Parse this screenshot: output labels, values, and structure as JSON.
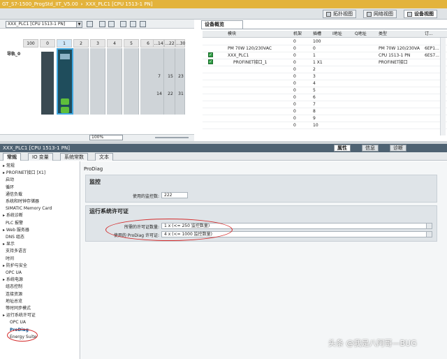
{
  "titlebar": {
    "project": "GT_S7-1500_ProgStd_IIT_V5.00",
    "sep": "›",
    "device": "XXX_PLC1 [CPU 1513-1 PN]"
  },
  "viewtabs": {
    "topology": "拓扑视图",
    "network": "网络视图",
    "device": "设备视图"
  },
  "devview": {
    "device_select": "XXX_PLC1 [CPU 1513-1 PN]",
    "slots": [
      "100",
      "0",
      "1",
      "2",
      "3",
      "4",
      "5",
      "6",
      "...14",
      "...22",
      "...30"
    ],
    "rail_label": "导轨_0",
    "io_numbers": [
      "7",
      "15",
      "23",
      "14",
      "22",
      "31"
    ],
    "zoom": "100%"
  },
  "overview": {
    "tab": "设备概览",
    "headers": [
      "模块",
      "机架",
      "插槽",
      "I地址",
      "Q地址",
      "类型",
      "订..."
    ],
    "rows": [
      {
        "module": "",
        "rack": "0",
        "slot": "100",
        "type": "",
        "order": "",
        "checked": false
      },
      {
        "module": "PM 70W 120/230VAC",
        "rack": "0",
        "slot": "0",
        "type": "PM 70W 120/230VA",
        "order": "6EP1...",
        "checked": false
      },
      {
        "module": "XXX_PLC1",
        "rack": "0",
        "slot": "1",
        "type": "CPU 1513-1 PN",
        "order": "6ES7...",
        "checked": true
      },
      {
        "module": "PROFINET接口_1",
        "rack": "0",
        "slot": "1 X1",
        "type": "PROFINET接口",
        "order": "",
        "checked": true
      },
      {
        "module": "",
        "rack": "0",
        "slot": "2",
        "type": "",
        "order": "",
        "checked": false
      },
      {
        "module": "",
        "rack": "0",
        "slot": "3",
        "type": "",
        "order": "",
        "checked": false
      },
      {
        "module": "",
        "rack": "0",
        "slot": "4",
        "type": "",
        "order": "",
        "checked": false
      },
      {
        "module": "",
        "rack": "0",
        "slot": "5",
        "type": "",
        "order": "",
        "checked": false
      },
      {
        "module": "",
        "rack": "0",
        "slot": "6",
        "type": "",
        "order": "",
        "checked": false
      },
      {
        "module": "",
        "rack": "0",
        "slot": "7",
        "type": "",
        "order": "",
        "checked": false
      },
      {
        "module": "",
        "rack": "0",
        "slot": "8",
        "type": "",
        "order": "",
        "checked": false
      },
      {
        "module": "",
        "rack": "0",
        "slot": "9",
        "type": "",
        "order": "",
        "checked": false
      },
      {
        "module": "",
        "rack": "0",
        "slot": "10",
        "type": "",
        "order": "",
        "checked": false
      }
    ]
  },
  "props": {
    "header": "XXX_PLC1 [CPU 1513-1 PN]",
    "tab_properties": "属性",
    "tab_info": "信息",
    "tab_diag": "诊断",
    "subtabs": [
      "常规",
      "IO 变量",
      "系统常数",
      "文本"
    ],
    "nav": [
      "常规",
      "PROFINET接口 [X1]",
      "启动",
      "循环",
      "通信负载",
      "系统和时钟存储器",
      "SIMATIC Memory Card",
      "系统诊断",
      "PLC 报警",
      "Web 服务器",
      "DNS 组态",
      "显示",
      "支持多语言",
      "时间",
      "防护与安全",
      "OPC UA",
      "系统电源",
      "组态控制",
      "连接资源",
      "地址总览",
      "等时同步模式",
      "运行系统许可证",
      "OPC UA",
      "ProDiag",
      "Energy Suite"
    ],
    "breadcrumb": "ProDiag",
    "monitor": {
      "title": "监控",
      "label": "使用的监控数:",
      "value": "222"
    },
    "license": {
      "title": "运行系统许可证",
      "required_label": "所需的许可证数量:",
      "required_value": "1 x (<= 250 监控数量)",
      "used_label": "使用的 ProDiag 许可证:",
      "used_value": "4 x (<= 1000 监控数量)"
    }
  },
  "watermark": "头条 @我是八阿哥—BUG"
}
